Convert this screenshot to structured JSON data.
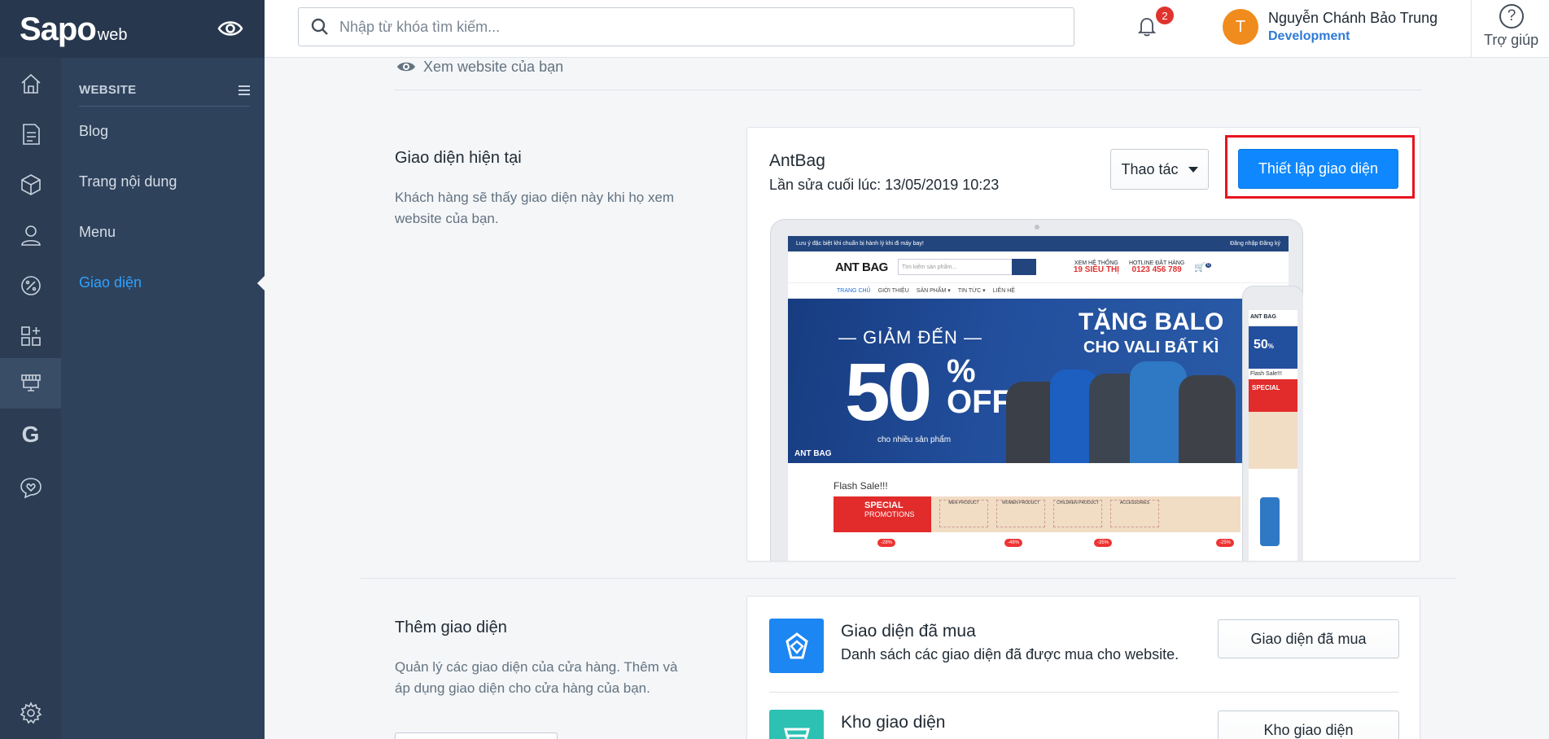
{
  "brand": {
    "name": "Sapo",
    "suffix": "web"
  },
  "header": {
    "search_placeholder": "Nhập từ khóa tìm kiếm...",
    "notification_count": "2",
    "avatar_initial": "T",
    "user_name": "Nguyễn Chánh Bảo Trung",
    "user_role": "Development",
    "help_label": "Trợ giúp"
  },
  "rail": {
    "icons": [
      "home-icon",
      "orders-icon",
      "products-icon",
      "customers-icon",
      "discounts-icon",
      "apps-icon",
      "website-icon",
      "google-icon",
      "chat-icon",
      "settings-icon"
    ]
  },
  "subnav": {
    "section_title": "WEBSITE",
    "items": [
      {
        "label": "Blog"
      },
      {
        "label": "Trang nội dung"
      },
      {
        "label": "Menu"
      },
      {
        "label": "Giao diện"
      }
    ]
  },
  "main": {
    "view_site_label": "Xem website của bạn",
    "current_theme": {
      "title": "Giao diện hiện tại",
      "description": "Khách hàng sẽ thấy giao diện này khi họ xem website của bạn.",
      "theme_name": "AntBag",
      "last_edited": "Lần sửa cuối lúc: 13/05/2019 10:23",
      "actions_label": "Thao tác",
      "customize_label": "Thiết lập giao diện"
    },
    "preview": {
      "topbar_text": "Lưu ý đặc biệt khi chuẩn bị hành lý khi đi máy bay!",
      "topbar_right": "Đăng nhập   Đăng ký",
      "logo": "ANT BAG",
      "search_placeholder": "Tìm kiếm sản phẩm...",
      "stores_label": "XEM HỆ THỐNG",
      "stores_value": "19 SIÊU THỊ",
      "hotline_label": "HOTLINE ĐẶT HÀNG",
      "hotline_value": "0123 456 789",
      "cart_count": "0",
      "nav": [
        "TRANG CHỦ",
        "GIỚI THIỆU",
        "SẢN PHẨM ▾",
        "TIN TỨC ▾",
        "LIÊN HỆ"
      ],
      "banner_line1": "GIẢM ĐẾN",
      "banner_big": "50",
      "banner_pct": "%",
      "banner_off": "OFF",
      "banner_sub": "cho nhiều sản phẩm",
      "banner_right": "TẶNG BALO",
      "banner_right2": "CHO VALI BẤT KÌ",
      "flash_sale": "Flash Sale!!!",
      "promo_title": "SPECIAL",
      "promo_sub": "PROMOTIONS",
      "promo_cells": [
        "MEN PRODUCT",
        "WOMEN PRODUCT",
        "CHILDREN PRODUCT",
        "ACCESSORIES"
      ],
      "tags": [
        "-28%",
        "-48%",
        "-35%",
        "-25%"
      ]
    },
    "add_theme": {
      "title": "Thêm giao diện",
      "description": "Quản lý các giao diện của cửa hàng. Thêm và áp dụng giao diện cho cửa hàng của bạn.",
      "rows": [
        {
          "title": "Giao diện đã mua",
          "desc": "Danh sách các giao diện đã được mua cho website.",
          "button": "Giao diện đã mua"
        },
        {
          "title": "Kho giao diện",
          "button": "Kho giao diện"
        }
      ]
    }
  },
  "colors": {
    "primary": "#0f88ff",
    "sidebar": "#2f425c",
    "rail": "#2b3c53",
    "highlight": "#e8141f",
    "accent_link": "#2ea2ff"
  }
}
